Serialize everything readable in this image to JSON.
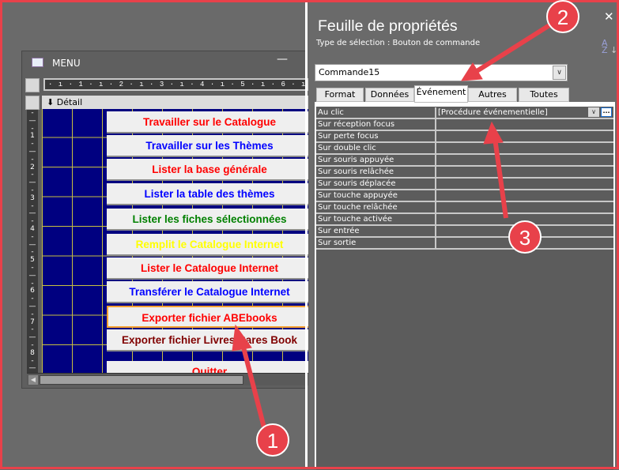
{
  "form_window": {
    "title": "MENU",
    "minimize": "—",
    "ruler": "· ı · 1 · ı · 2 · ı · 3 · ı · 4 · ı · 5 · ı · 6 · ı · 7 · ı · 8 · ı",
    "section": "Détail",
    "vruler": [
      "-",
      "—",
      "-",
      "1",
      "-",
      "—",
      "-",
      "2",
      "-",
      "—",
      "-",
      "3",
      "-",
      "—",
      "-",
      "4",
      "-",
      "—",
      "-",
      "5",
      "-",
      "—",
      "-",
      "6",
      "-",
      "—",
      "-",
      "7",
      "-",
      "—",
      "-",
      "8",
      "-",
      "—"
    ],
    "buttons": [
      {
        "label": "Travailler sur le Catalogue",
        "color": "#ff0000"
      },
      {
        "label": "Travailler sur les Thèmes",
        "color": "#0000ff"
      },
      {
        "label": "Lister la base générale",
        "color": "#ff0000"
      },
      {
        "label": "Lister la table des thèmes",
        "color": "#0000ff"
      },
      {
        "label": "Lister les fiches sélectionnées",
        "color": "#008000"
      },
      {
        "label": "Remplit le Catalogue Internet",
        "color": "#ffff00"
      },
      {
        "label": "Lister le Catalogue Internet",
        "color": "#ff0000"
      },
      {
        "label": "Transférer le Catalogue Internet",
        "color": "#0000ff"
      },
      {
        "label": "Exporter fichier ABEbooks",
        "color": "#ff0000",
        "selected": true
      },
      {
        "label": "Exporter fichier Livres Rares Book",
        "color": "#800000"
      },
      {
        "label": "Quitter",
        "color": "#ff0000"
      }
    ]
  },
  "property_sheet": {
    "title": "Feuille de propriétés",
    "selection_type": "Type de sélection :  Bouton de commande",
    "object": "Commande15",
    "tabs": [
      {
        "label": "Format"
      },
      {
        "label": "Données"
      },
      {
        "label": "Événement",
        "active": true
      },
      {
        "label": "Autres"
      },
      {
        "label": "Toutes"
      }
    ],
    "properties": [
      {
        "name": "Au clic",
        "value": "[Procédure événementielle]"
      },
      {
        "name": "Sur réception focus",
        "value": ""
      },
      {
        "name": "Sur perte focus",
        "value": ""
      },
      {
        "name": "Sur double clic",
        "value": ""
      },
      {
        "name": "Sur souris appuyée",
        "value": ""
      },
      {
        "name": "Sur souris relâchée",
        "value": ""
      },
      {
        "name": "Sur souris déplacée",
        "value": ""
      },
      {
        "name": "Sur touche appuyée",
        "value": ""
      },
      {
        "name": "Sur touche relâchée",
        "value": ""
      },
      {
        "name": "Sur touche activée",
        "value": ""
      },
      {
        "name": "Sur entrée",
        "value": ""
      },
      {
        "name": "Sur sortie",
        "value": ""
      }
    ],
    "builder_button": "...",
    "close": "✕",
    "sort_icon": "A↓Z"
  },
  "annotations": {
    "accent": "#e8414a",
    "markers": [
      "1",
      "2",
      "3"
    ]
  }
}
